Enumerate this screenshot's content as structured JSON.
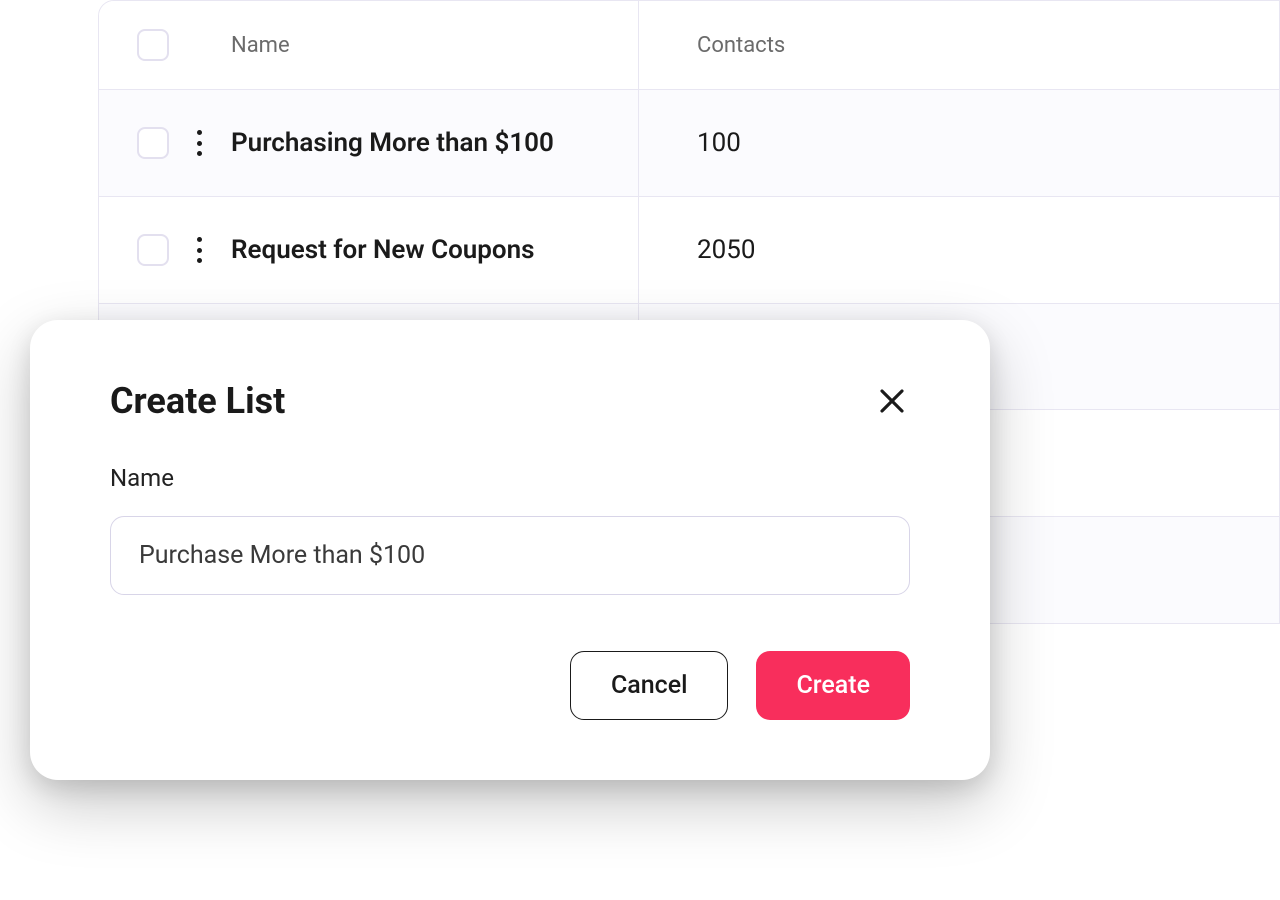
{
  "table": {
    "headers": {
      "name": "Name",
      "contacts": "Contacts"
    },
    "rows": [
      {
        "name": "Purchasing More than $100",
        "contacts": "100"
      },
      {
        "name": "Request for New Coupons",
        "contacts": "2050"
      }
    ]
  },
  "modal": {
    "title": "Create List",
    "field_label": "Name",
    "input_value": "Purchase More than $100",
    "cancel_label": "Cancel",
    "create_label": "Create"
  }
}
